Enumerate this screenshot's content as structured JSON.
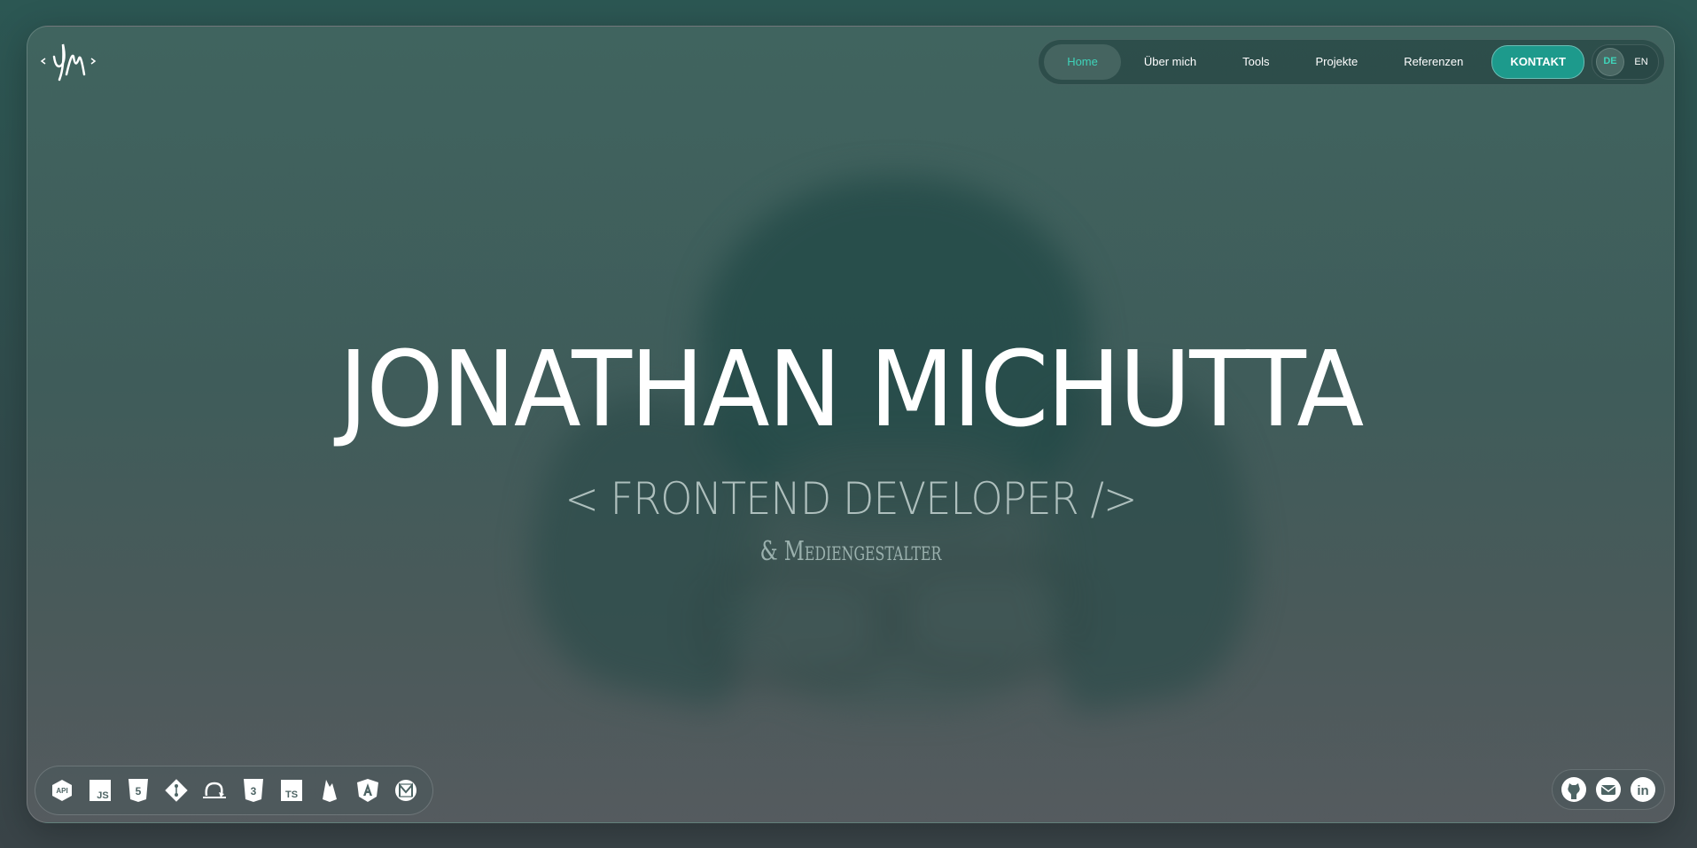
{
  "logo": {
    "icon": "jm-logo-icon"
  },
  "nav": {
    "items": [
      {
        "label": "Home",
        "active": true
      },
      {
        "label": "Über mich",
        "active": false
      },
      {
        "label": "Tools",
        "active": false
      },
      {
        "label": "Projekte",
        "active": false
      },
      {
        "label": "Referenzen",
        "active": false
      }
    ],
    "contact_label": "KONTAKT",
    "languages": [
      {
        "label": "DE",
        "active": true
      },
      {
        "label": "EN",
        "active": false
      }
    ]
  },
  "hero": {
    "name": "JONATHAN MICHUTTA",
    "role": "< FRONTEND DEVELOPER />",
    "subtitle": "& Mediengestalter"
  },
  "skills": [
    "api-icon",
    "javascript-icon",
    "html5-icon",
    "git-icon",
    "scrum-icon",
    "css3-icon",
    "typescript-icon",
    "firebase-icon",
    "angular-icon",
    "material-design-icon"
  ],
  "socials": [
    "github-icon",
    "email-icon",
    "linkedin-icon"
  ],
  "colors": {
    "accent": "#3fd3b9",
    "button": "#1d9a8c"
  }
}
